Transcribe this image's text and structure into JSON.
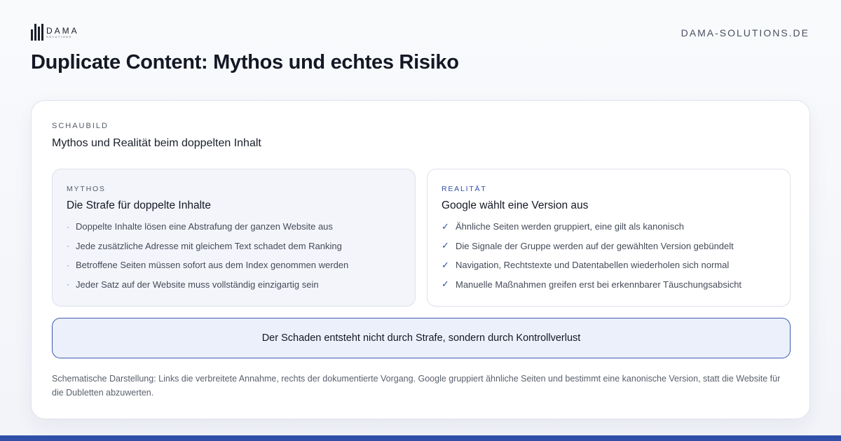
{
  "brand": {
    "logo_word": "DAMA",
    "logo_sub": "SOLUTIONS",
    "domain": "DAMA-SOLUTIONS.DE"
  },
  "page": {
    "title": "Duplicate Content: Mythos und echtes Risiko"
  },
  "card": {
    "eyebrow": "SCHAUBILD",
    "title": "Mythos und Realität beim doppelten Inhalt"
  },
  "myth": {
    "eyebrow": "MYTHOS",
    "title": "Die Strafe für doppelte Inhalte",
    "items": [
      "Doppelte Inhalte lösen eine Abstrafung der ganzen Website aus",
      "Jede zusätzliche Adresse mit gleichem Text schadet dem Ranking",
      "Betroffene Seiten müssen sofort aus dem Index genommen werden",
      "Jeder Satz auf der Website muss vollständig einzigartig sein"
    ]
  },
  "reality": {
    "eyebrow": "REALITÄT",
    "title": "Google wählt eine Version aus",
    "items": [
      "Ähnliche Seiten werden gruppiert, eine gilt als kanonisch",
      "Die Signale der Gruppe werden auf der gewählten Version gebündelt",
      "Navigation, Rechtstexte und Datentabellen wiederholen sich normal",
      "Manuelle Maßnahmen greifen erst bei erkennbarer Täuschungsabsicht"
    ]
  },
  "summary": "Der Schaden entsteht nicht durch Strafe, sondern durch Kontrollverlust",
  "caption": "Schematische Darstellung: Links die verbreitete Annahme, rechts der dokumentierte Vorgang. Google gruppiert ähnliche Seiten und bestimmt eine kanonische Version, statt die Website für die Dubletten abzuwerten.",
  "colors": {
    "accent": "#2f4fa8",
    "summary_bg": "#ebf0fa",
    "myth_panel_bg": "#f3f5fa"
  },
  "icons": {
    "myth_bullet": "bullet-dot-icon",
    "reality_bullet": "checkmark-icon"
  }
}
